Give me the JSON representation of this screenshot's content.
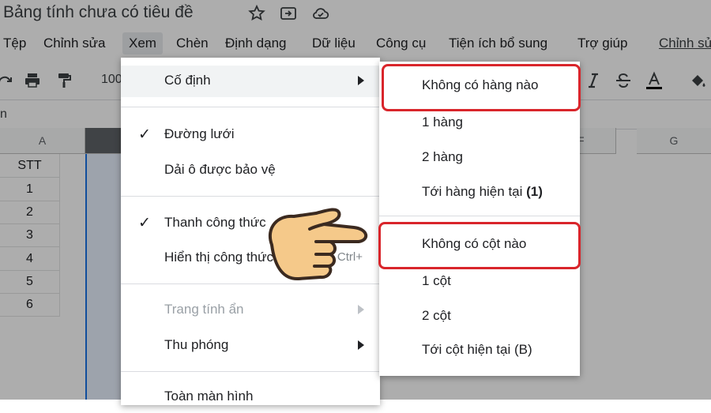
{
  "doc": {
    "title": "Bảng tính chưa có tiêu đề",
    "title_icons": [
      "star-icon",
      "move-to-folder-icon",
      "cloud-status-icon"
    ]
  },
  "menubar": {
    "items": [
      "Tệp",
      "Chỉnh sửa",
      "Xem",
      "Chèn",
      "Định dạng",
      "Dữ liệu",
      "Công cụ",
      "Tiện ích bổ sung",
      "Trợ giúp",
      "Chỉnh sửa"
    ],
    "active": "Xem"
  },
  "toolbar": {
    "zoom": "100",
    "icons": [
      "redo-icon",
      "print-icon",
      "paint-format-icon",
      "italic-icon",
      "strikethrough-icon",
      "text-color-icon",
      "fill-color-icon"
    ],
    "text_color": "#000000"
  },
  "formula_bar": {
    "text": "n"
  },
  "grid": {
    "columns": [
      "A",
      "",
      "F",
      "G"
    ],
    "header_cell": "STT",
    "rows": [
      "1",
      "2",
      "3",
      "4",
      "5",
      "6"
    ]
  },
  "view_menu": {
    "items": [
      {
        "label": "Cố định",
        "submenu": true
      },
      {
        "label": "Đường lưới",
        "checked": true
      },
      {
        "label": "Dải ô được bảo vệ"
      },
      {
        "label": "Thanh công thức",
        "checked": true
      },
      {
        "label": "Hiển thị công thức",
        "shortcut": "Ctrl+"
      },
      {
        "label": "Trang tính ẩn",
        "submenu": true,
        "disabled": true
      },
      {
        "label": "Thu phóng",
        "submenu": true
      },
      {
        "label": "Toàn màn hình"
      }
    ]
  },
  "freeze_submenu": {
    "items": [
      {
        "label": "Không có hàng nào",
        "highlighted": true
      },
      {
        "label": "1 hàng"
      },
      {
        "label": "2 hàng"
      },
      {
        "label": "Tới hàng hiện tại",
        "suffix": "(1)"
      },
      {
        "label": "Không có cột nào",
        "highlighted": true
      },
      {
        "label": "1 cột"
      },
      {
        "label": "2 cột"
      },
      {
        "label": "Tới cột hiện tại",
        "suffix": "(B)"
      }
    ]
  },
  "colors": {
    "highlight_border": "#d9252b",
    "selection_blue": "#1a73e8",
    "hand_fill": "#f5c98a",
    "hand_outline": "#3b2a20"
  }
}
